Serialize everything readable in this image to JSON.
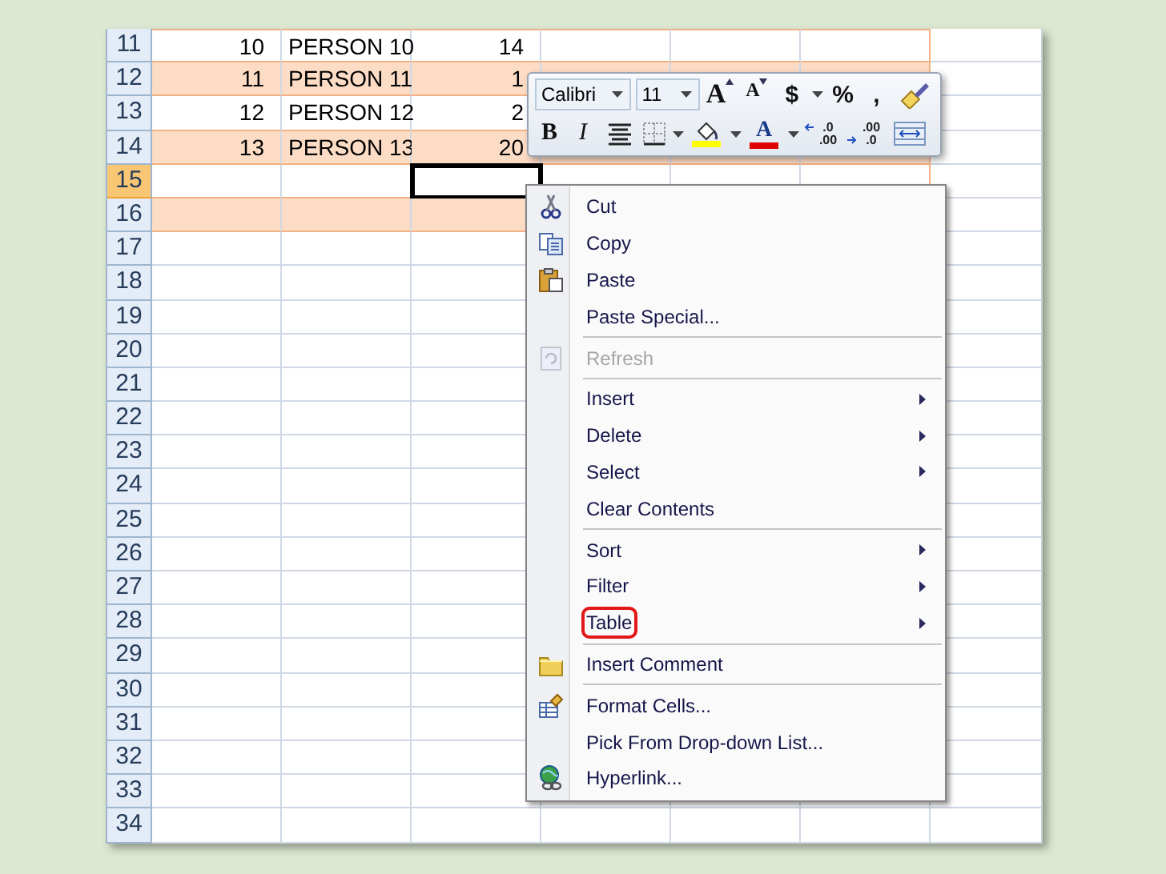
{
  "sheet": {
    "rows": [
      {
        "header": "11",
        "selected": false,
        "in_table": true,
        "banded": false,
        "cells": [
          {
            "kind": "number",
            "text": "10"
          },
          {
            "kind": "text",
            "text": "PERSON 10"
          },
          {
            "kind": "number",
            "text": "14"
          }
        ]
      },
      {
        "header": "12",
        "selected": false,
        "in_table": true,
        "banded": true,
        "cells": [
          {
            "kind": "number",
            "text": "11"
          },
          {
            "kind": "text",
            "text": "PERSON 11"
          },
          {
            "kind": "number",
            "text": "1"
          }
        ]
      },
      {
        "header": "13",
        "selected": false,
        "in_table": true,
        "banded": false,
        "cells": [
          {
            "kind": "number",
            "text": "12"
          },
          {
            "kind": "text",
            "text": "PERSON 12"
          },
          {
            "kind": "number",
            "text": "2"
          }
        ]
      },
      {
        "header": "14",
        "selected": false,
        "in_table": true,
        "banded": true,
        "cells": [
          {
            "kind": "number",
            "text": "13"
          },
          {
            "kind": "text",
            "text": "PERSON 13"
          },
          {
            "kind": "number",
            "text": "20"
          }
        ]
      },
      {
        "header": "15",
        "selected": true,
        "in_table": true,
        "banded": false
      },
      {
        "header": "16",
        "selected": false,
        "in_table": true,
        "banded": true
      },
      {
        "header": "17",
        "selected": false,
        "in_table": false,
        "banded": false
      },
      {
        "header": "18",
        "selected": false,
        "in_table": false,
        "banded": false
      },
      {
        "header": "19",
        "selected": false,
        "in_table": false,
        "banded": false
      },
      {
        "header": "20",
        "selected": false,
        "in_table": false,
        "banded": false
      },
      {
        "header": "21",
        "selected": false,
        "in_table": false,
        "banded": false
      },
      {
        "header": "22",
        "selected": false,
        "in_table": false,
        "banded": false
      },
      {
        "header": "23",
        "selected": false,
        "in_table": false,
        "banded": false
      },
      {
        "header": "24",
        "selected": false,
        "in_table": false,
        "banded": false
      },
      {
        "header": "25",
        "selected": false,
        "in_table": false,
        "banded": false
      },
      {
        "header": "26",
        "selected": false,
        "in_table": false,
        "banded": false
      },
      {
        "header": "27",
        "selected": false,
        "in_table": false,
        "banded": false
      },
      {
        "header": "28",
        "selected": false,
        "in_table": false,
        "banded": false
      },
      {
        "header": "29",
        "selected": false,
        "in_table": false,
        "banded": false
      },
      {
        "header": "30",
        "selected": false,
        "in_table": false,
        "banded": false
      },
      {
        "header": "31",
        "selected": false,
        "in_table": false,
        "banded": false
      },
      {
        "header": "32",
        "selected": false,
        "in_table": false,
        "banded": false
      },
      {
        "header": "33",
        "selected": false,
        "in_table": false,
        "banded": false
      },
      {
        "header": "34",
        "selected": false,
        "in_table": false,
        "banded": false
      }
    ]
  },
  "mini_toolbar": {
    "font_name": "Calibri",
    "font_size": "11",
    "row_1": [
      {
        "kind": "grow",
        "label": "A"
      },
      {
        "kind": "shrink",
        "label": "A"
      },
      {
        "kind": "text",
        "label": "$"
      },
      {
        "kind": "dropdown"
      },
      {
        "kind": "text",
        "label": "%"
      },
      {
        "kind": "text",
        "label": ","
      },
      {
        "kind": "painter"
      }
    ],
    "row_2": [
      {
        "kind": "bold",
        "label": "B"
      },
      {
        "kind": "italic",
        "label": "I"
      },
      {
        "kind": "center"
      },
      {
        "kind": "borders"
      },
      {
        "kind": "dropdown"
      },
      {
        "kind": "fill",
        "color": "#ffff00"
      },
      {
        "kind": "dropdown"
      },
      {
        "kind": "fontcolor",
        "label": "A",
        "color": "#e00000"
      },
      {
        "kind": "dropdown"
      },
      {
        "kind": "add_decimal",
        "top": ".0",
        "bottom": ".00"
      },
      {
        "kind": "remove_decimal",
        "top": ".00",
        "bottom": ".0"
      },
      {
        "kind": "merge"
      }
    ]
  },
  "context_menu": {
    "groups": [
      [
        {
          "label": "Cut",
          "disabled": false,
          "submenu": false,
          "highlighted": false
        },
        {
          "label": "Copy",
          "disabled": false,
          "submenu": false,
          "highlighted": false
        },
        {
          "label": "Paste",
          "disabled": false,
          "submenu": false,
          "highlighted": false
        },
        {
          "label": "Paste Special...",
          "disabled": false,
          "submenu": false,
          "highlighted": false
        }
      ],
      [
        {
          "label": "Refresh",
          "disabled": true,
          "submenu": false,
          "highlighted": false
        }
      ],
      [
        {
          "label": "Insert",
          "disabled": false,
          "submenu": true,
          "highlighted": false
        },
        {
          "label": "Delete",
          "disabled": false,
          "submenu": true,
          "highlighted": false
        },
        {
          "label": "Select",
          "disabled": false,
          "submenu": true,
          "highlighted": false
        },
        {
          "label": "Clear Contents",
          "disabled": false,
          "submenu": false,
          "highlighted": false
        }
      ],
      [
        {
          "label": "Sort",
          "disabled": false,
          "submenu": true,
          "highlighted": false
        },
        {
          "label": "Filter",
          "disabled": false,
          "submenu": true,
          "highlighted": false
        },
        {
          "label": "Table",
          "disabled": false,
          "submenu": true,
          "highlighted": true
        }
      ],
      [
        {
          "label": "Insert Comment",
          "disabled": false,
          "submenu": false,
          "highlighted": false
        }
      ],
      [
        {
          "label": "Format Cells...",
          "disabled": false,
          "submenu": false,
          "highlighted": false
        },
        {
          "label": "Pick From Drop-down List...",
          "disabled": false,
          "submenu": false,
          "highlighted": false
        },
        {
          "label": "Hyperlink...",
          "disabled": false,
          "submenu": false,
          "highlighted": false
        }
      ]
    ]
  }
}
